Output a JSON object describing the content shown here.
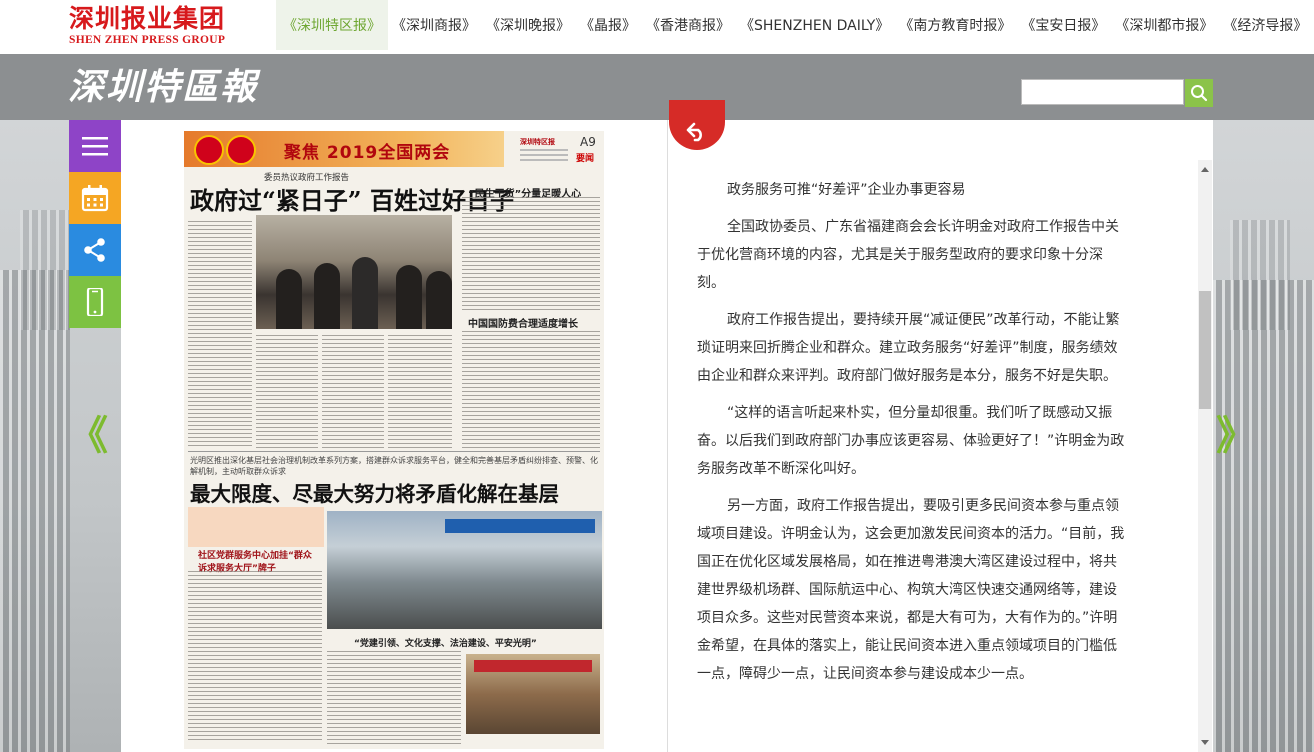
{
  "group_logo": {
    "cn": "深圳报业集团",
    "en": "SHEN ZHEN PRESS GROUP"
  },
  "nav": [
    {
      "label": "《深圳特区报》",
      "active": true
    },
    {
      "label": "《深圳商报》"
    },
    {
      "label": "《深圳晚报》"
    },
    {
      "label": "《晶报》"
    },
    {
      "label": "《香港商报》"
    },
    {
      "label": "《SHENZHEN DAILY》"
    },
    {
      "label": "《南方教育时报》"
    },
    {
      "label": "《宝安日报》"
    },
    {
      "label": "《深圳都市报》"
    },
    {
      "label": "《经济导报》"
    }
  ],
  "paper_logo": "深圳特區報",
  "search": {
    "value": "",
    "placeholder": ""
  },
  "side_buttons": [
    "menu-icon",
    "calendar-icon",
    "share-icon",
    "mobile-icon"
  ],
  "arrows": {
    "prev": "《",
    "next": "》"
  },
  "newspaper": {
    "band_title": "聚焦 2019全国两会",
    "page": "A9",
    "section": "要闻",
    "masthead": "深圳特区报",
    "kicker": "委员热议政府工作报告",
    "headline1": "政府过“紧日子” 百姓过好日子",
    "subhead1": "“民生干货”分量足暖人心",
    "subhead2": "中国国防费合理适度增长",
    "deck": "光明区推出深化基层社会治理机制改革系列方案，搭建群众诉求服务平台，健全和完善基层矛盾纠纷排查、预警、化解机制，主动听取群众诉求",
    "headline2": "最大限度、尽最大努力将矛盾化解在基层",
    "subhead3": "社区党群服务中心加挂“群众诉求服务大厅”牌子",
    "subhead4": "“党建引领、文化支撑、法治建设、平安光明”"
  },
  "article": {
    "paragraphs": [
      "政务服务可推“好差评”企业办事更容易",
      "全国政协委员、广东省福建商会会长许明金对政府工作报告中关于优化营商环境的内容，尤其是关于服务型政府的要求印象十分深刻。",
      "政府工作报告提出，要持续开展“减证便民”改革行动，不能让繁琐证明来回折腾企业和群众。建立政务服务“好差评”制度，服务绩效由企业和群众来评判。政府部门做好服务是本分，服务不好是失职。",
      "“这样的语言听起来朴实，但分量却很重。我们听了既感动又振奋。以后我们到政府部门办事应该更容易、体验更好了！”许明金为政务服务改革不断深化叫好。",
      "另一方面，政府工作报告提出，要吸引更多民间资本参与重点领域项目建设。许明金认为，这会更加激发民间资本的活力。“目前，我国正在优化区域发展格局，如在推进粤港澳大湾区建设过程中，将共建世界级机场群、国际航运中心、构筑大湾区快速交通网络等，建设项目众多。这些对民营资本来说，都是大有可为，大有作为的。”许明金希望，在具体的落实上，能让民间资本进入重点领域项目的门槛低一点，障碍少一点，让民间资本参与建设成本少一点。"
    ]
  },
  "colors": {
    "brand_red": "#d7191c",
    "accent_green": "#7dc242",
    "menu_purple": "#8e44c7",
    "calendar_orange": "#f5a623",
    "share_blue": "#2a8be0"
  }
}
